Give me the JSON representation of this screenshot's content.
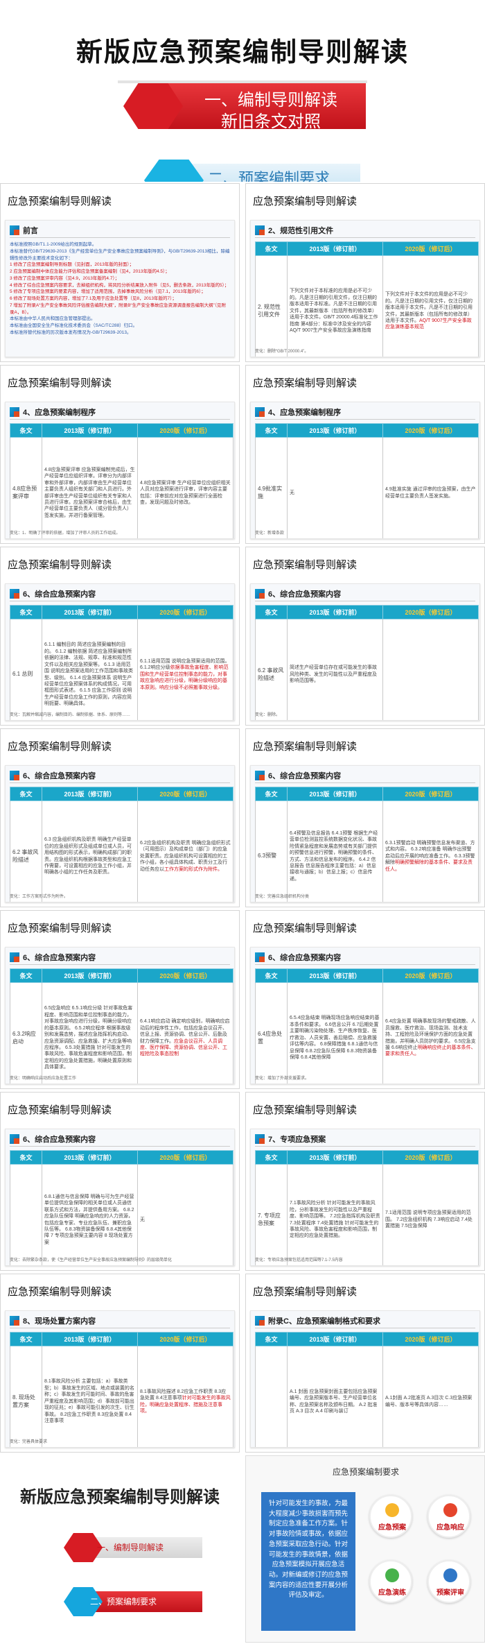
{
  "banner": {
    "title": "新版应急预案编制导则解读",
    "ribbon_line1": "一、编制导则解读",
    "ribbon_line2": "新旧条文对照",
    "sub_ribbon": "二、预案编制要求"
  },
  "slide_header": "应急预案编制导则解读",
  "table_headers": {
    "col1": "条文",
    "col2013": "2013版（修订前）",
    "col2020": "2020版（修订后）"
  },
  "slides": [
    {
      "section": "前言",
      "preface_lines": [
        {
          "text": "本标准按照GB/T1.1-2009给出的规则起草。",
          "red": false
        },
        {
          "text": "本标准替代GB/T29639-2013《生产经营单位生产安全事故应急预案编制导则》，与GB/T29639-2013相比，除编辑性修改外主要技术变化如下：",
          "red": false
        },
        {
          "text": "1  修改了应急预案编制导则标题（见封面，2013年版的封面）；",
          "red": true
        },
        {
          "text": "2  应急预案编制中体应急能力评估和应急预案备案编制（见4，2013年版的4.5）；",
          "red": true
        },
        {
          "text": "3  修改了应急预案评审内容（见4.9，2013年版的4.7）；",
          "red": true
        },
        {
          "text": "4  修改了综合应急预案内容要求，去掉组织机构，将风险分析结果放入附件（见5，删去条款，2013年版的5）；",
          "red": true
        },
        {
          "text": "5  修改了专项应急预案的要素内容，增加了适用范围，去掉事故风险分析（见7.1，2013年版的6）；",
          "red": true
        },
        {
          "text": "6  修改了现场处置方案的内容，增加了7.1及用于应急处置等（见8，2013年版的7）；",
          "red": true
        },
        {
          "text": "7  增加了附录A“生产安全事故风险评估报告编制大纲”，附录B“生产安全事故应急资源调查报告编制大纲”（见附录A，B）。",
          "red": true
        },
        {
          "text": "本标准由中华人民共和国应急管理部提出。",
          "red": false
        },
        {
          "text": "本标准由全国安全生产标准化技术委员会（SAC/TC288）归口。",
          "red": false
        },
        {
          "text": "本标准所替代标准的历次版本发布情况为-GB/T29639-2013。",
          "red": false
        }
      ]
    },
    {
      "section": "2、规范性引用文件",
      "row_label": "2. 规范性引用文件",
      "old": "下列文件对于本标准的应用是必不可少的。凡是注日期的引用文件，仅注日期的版本适用于本标准。凡是不注日期的引用文件，其最新版本（包括所有的修改单）适用于本文件。GB/T 20000.4标准化工作指南 第4部分：标准中涉及安全的内容 AQ/T 9007生产安全事故应急演练指南",
      "new": "下列文件对于本文件的应用是必不可少的。凡是注日期的引用文件，仅注日期的版本适用于本文件。凡是不注日期的引用文件，其最新版本（包括所有的修改单）适用于本文件。",
      "new_red": "AQ/T 9007生产安全事故应急演练基本规范",
      "note": "变化：删除“GB/T 20000.4”。"
    },
    {
      "section": "4、应急预案编制程序",
      "row_label": "4.8应急预案评审",
      "old": "4.8应急预案评审 应急预案编制完成后，生产经营单位应组织评审。评审分为内部评审和外部评审，内部评审由生产经营单位主要负责人组织有关部门和人员进行。外部评审由生产经营单位组织有关专家和人员进行评审。应急预案评审合格后，由生产经营单位主要负责人（或分管负责人）签发实施，并进行备案管理。",
      "new": "4.8应急预案评审 生产经营单位应组织相关人员对应急预案进行评审，评审内容主要包括：评审前应对应急预案进行全面检查，发现问题及时修改。",
      "note": "变化：1、明确了评审的依据，增加了评审人员的工作组成。"
    },
    {
      "section": "4、应急预案编制程序",
      "row_label": "4.9批准实施",
      "old": "无",
      "new": "4.9批准实施 通过评审的应急预案，由生产经营单位主要负责人签发实施。",
      "note": "变化：新增条款"
    },
    {
      "section": "6、综合应急预案内容",
      "row_label": "6.1 总则",
      "old": "6.1.1 编制目的 简述应急预案编制的目的。 6.1.2 编制依据 简述应急预案编制所依据的法律、法规、规章、标准和规范性文件以及相关应急预案等。 6.1.3 适用范围 说明应急预案适用的工作范围和事故类型、级别。 6.1.4 应急预案体系 说明生产经营单位应急预案体系的构成情况，可用框图形式表述。 6.1.5 应急工作原则 说明生产经营单位应急工作的原则，内容应简明扼要、明确具体。",
      "new": "6.1.1适用范围 说明应急预案适用的范围。 6.1.2响应分级",
      "new_red": "依据事故危害程度、影响范围和生产经营单位控制事态的能力，对事故应急响应进行分级，明确分级响应的基本原则。响应分级不必照搬事故分级。",
      "note": "变化：瓦解并缩减内容，编制目的、编制依据、体系、原则等……"
    },
    {
      "section": "6、综合应急预案内容",
      "row_label": "6.2 事故风险描述",
      "old": "简述生产经营单位存在或可能发生的事故风险种类、发生的可能性以及严重程度及影响范围等。",
      "new": "",
      "note": "变化：删除。"
    },
    {
      "section": "6、综合应急预案内容",
      "row_label": "6.2 事故风险描述",
      "old": "6.3 应急组织机构及职责 明确生产经营单位的应急组织形式及组成单位或人员，可用结构图的形式表示，明确构成部门的职责。应急组织机构根据事故类型和应急工作需要，可设置相应的应急工作小组，并明确各小组的工作任务及职责。",
      "new": "6.2应急组织机构及职责 明确应急组织形式（可用图示）及构成单位（部门）的应急处置职责。应急组织机构可设置相应的工作小组，各小组具体构成、职责分工及行动任务应以",
      "new_red": "工作方案的形式作为附件。",
      "note": "变化：工作方案形式作为附件。"
    },
    {
      "section": "6、综合应急预案内容",
      "row_label": "6.3预警",
      "old": "6.4预警及信息报告 6.4.1预警 根据生产经营单位检测监控系统数据变化状况、事故险情紧急程度和发展态势或有关部门提供的预警信息进行预警，明确预警的条件、方式、方法和信息发布的程序。 6.4.2 信息报告 信息报告程序主要包括：a）信息接收与通报；b）信息上报；c）信息传递。",
      "new": "6.3.1预警启动 明确预警信息发布渠道、方式和内容。 6.3.2响应准备 明确作出预警启动后应开展的响应准备工作。 6.3.3预警解除",
      "new_red": "明确预警解除的基本条件、要求及责任人。",
      "note": "变化：完善应急组织机构分类"
    },
    {
      "section": "6、综合应急预案内容",
      "row_label": "6.3.2响应启动",
      "old": "6.5应急响应 6.5.1响应分级 针对事故危害程度、影响范围和单位控制事态的能力，对事故应急响应进行分级，明确分级响应的基本原则。 6.5.2响应程序 根据事故级别和发展态势，描述应急指挥机构启动、应急资源调配、应急救援、扩大应急等响应程序。 6.5.3处置措施 针对可能发生的事故风险、事故危害程度和影响范围，制定相应的应急处置措施，明确处置原则和具体要求。",
      "new": "6.4.1响应启动 确定响应级别，明确响应启动后的程序性工作，包括应急会议召开、信息上报、资源协调、信息公开、后勤及财力保障工作。",
      "new_red": "应急会议召开、人员调度、医疗保障、资源协调、信息公开、工程抢险及事态控制",
      "note": "变化：明确响应启动后应急处置工作"
    },
    {
      "section": "6、综合应急预案内容",
      "row_label": "6.4应急处置",
      "old": "6.5.4应急结束 明确现场应急响应结束的基本条件和要求。 6.6信息公开 6.7后期处置 主要明确污染物处理、生产秩序恢复、医疗救治、人员安置、善后赔偿、应急救援评估等内容。 6.8保障措施 6.8.1通信与信息保障 6.8.2应急队伍保障 6.8.3物资装备保障 6.8.4其他保障",
      "new": "6.4应急处置 明确事故现场的警戒疏散、人员搜救、医疗救治、现场监测、技术支持、工程抢险及环境保护方面的应急处置措施，并明确人员防护的要求。 6.5应急支援 6.6响应终止",
      "new_red": "明确响应终止的基本条件、要求和责任人。",
      "note": "变化：增加了外部支援要求。"
    },
    {
      "section": "6、综合应急预案内容",
      "row_label": "",
      "old": "6.8.1通信与信息保障 明确与可为生产经营单位提供应急保障的相关单位或人员通信联系方式和方法，并提供备用方案。 6.8.2应急队伍保障 明确应急响应的人力资源，包括应急专家、专业应急队伍、兼职应急队伍等。 6.8.3物资装备保障 6.8.4其他保障 7 专项应急预案主要内容 8 现场处置方案",
      "new": "无",
      "note": "变化：去除繁杂条款，使《生产经营单位生产安全事故应急预案编制导则》的层级简单化"
    },
    {
      "section": "7、专项应急预案",
      "row_label": "7. 专项应急预案",
      "old": "7.1事故风险分析 针对可能发生的事故风险，分析事故发生的可能性以及严重程度、影响范围等。 7.2应急指挥机构及职责 7.3处置程序 7.4处置措施 针对可能发生的事故风险、事故危害程度和影响范围，制定相应的应急处置措施。",
      "new": "7.1适用范围 说明专项应急预案适用的范围。 7.2应急组织机构 7.3响应启动 7.4处置措施 7.5应急保障",
      "note": "变化：专项应急预案包括适用范围等7.1-7.5内容"
    },
    {
      "section": "8、现场处置方案内容",
      "row_label": "8. 现场处置方案",
      "old": "8.1事故风险分析 主要包括：a）事故类型；b）事故发生的区域、地点或装置的名称；c）事故发生的可能时间、事故的危害严重程度及其影响范围；d）事故前可能出现的征兆；e）事故可能引发的次生、衍生事故。 8.2应急工作职责 8.3应急处置 8.4注意事项",
      "new": "8.1事故风险描述 8.2应急工作职责 8.3应急处置 8.4注意事项",
      "new_red": "针对可能发生的事故风险，明确应急处置程序、措施及注意事项。",
      "note": "变化：完善具体要求"
    },
    {
      "section": "附录C、应急预案编制格式和要求",
      "row_label": "",
      "old": "A.1 封面 应急预案封面主要包括应急预案编号、应急预案版本号、生产经营单位名称、应急预案名称及颁布日期。 A.2 批准页 A.3 目次 A.4 印刷与装订",
      "new": "A.1封面 A.2批准页 A.3目次 C.3应急预案编号、版本号等具体内容……",
      "note": ""
    }
  ],
  "bottom_left": {
    "title": "新版应急预案编制导则解读",
    "item1": "一、编制导则解读",
    "item2": "二、预案编制要求"
  },
  "bottom_right": {
    "title": "应急预案编制要求",
    "text": "针对可能发生的事故，为最大程度减少事故损害而预先制定应急准备工作方案。针对事故险情或事故，依据应急预案采取应急行动。针对可能发生的事故情景，依据应急预案模拟开展应急活动。对新编或修订的应急预案内容的适应性要开展分析评估及审定。",
    "c1": "应急预案",
    "c2": "应急响应",
    "c3": "应急演练",
    "c4": "预案评审"
  }
}
